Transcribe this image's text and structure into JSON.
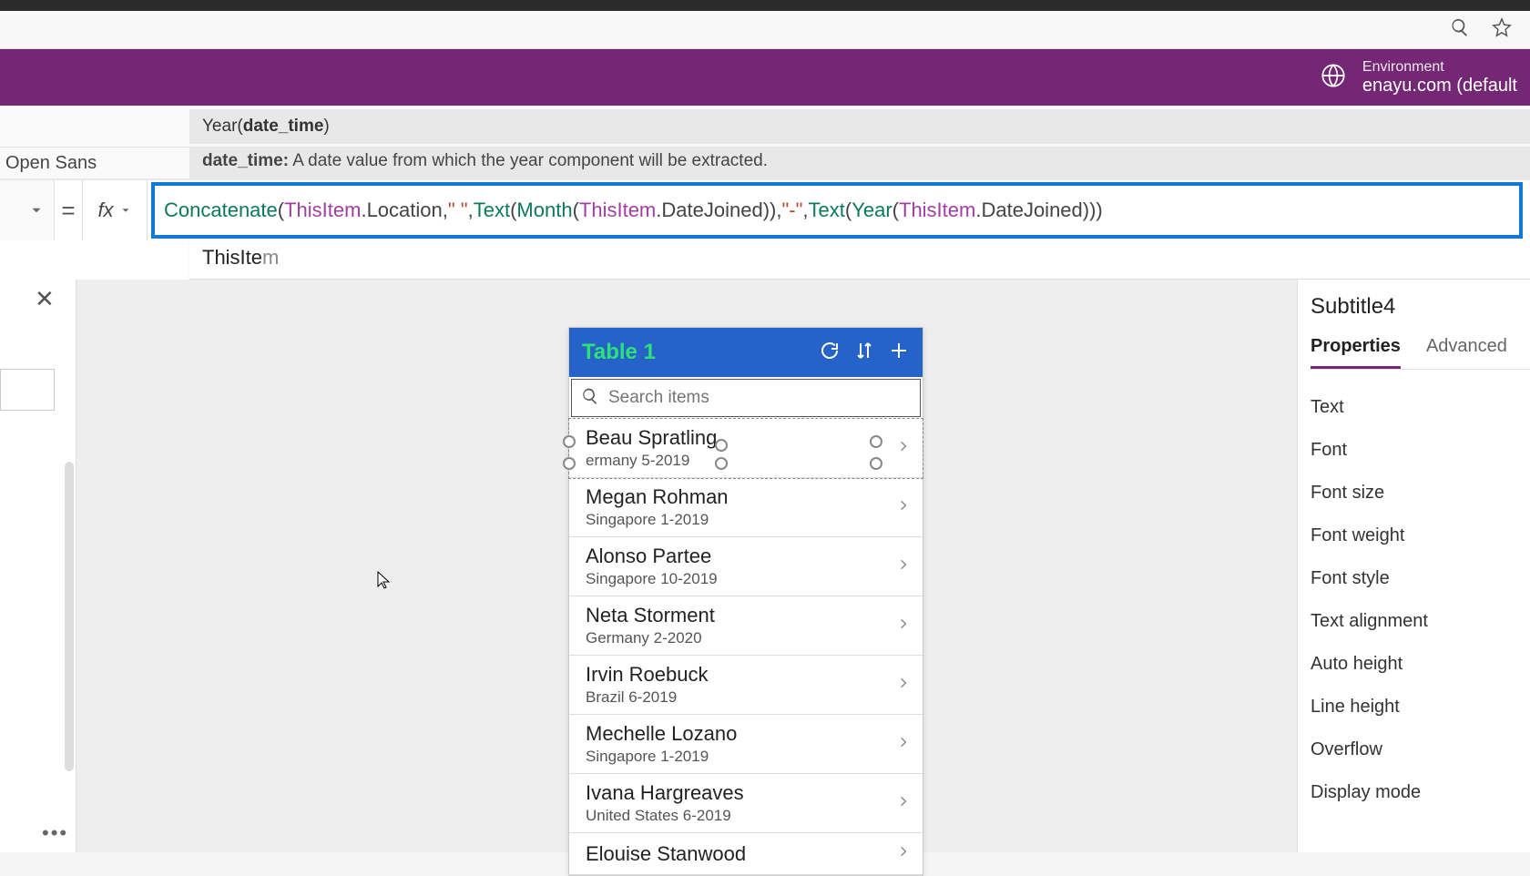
{
  "header": {
    "env_label": "Environment",
    "env_value": "enayu.com (default"
  },
  "toolbar": {
    "font": "Open Sans"
  },
  "signature": {
    "fn": "Year",
    "arg": "date_time",
    "param_name": "date_time:",
    "param_desc": "A date value from which the year component will be extracted."
  },
  "formula": {
    "tokens": [
      {
        "t": "fn",
        "v": "Concatenate"
      },
      {
        "t": "punc",
        "v": "("
      },
      {
        "t": "obj",
        "v": "ThisItem"
      },
      {
        "t": "prop",
        "v": ".Location"
      },
      {
        "t": "punc",
        "v": ", "
      },
      {
        "t": "str",
        "v": "\" \""
      },
      {
        "t": "punc",
        "v": ", "
      },
      {
        "t": "fn",
        "v": "Text"
      },
      {
        "t": "punc",
        "v": "("
      },
      {
        "t": "fn",
        "v": "Month"
      },
      {
        "t": "punc",
        "v": "("
      },
      {
        "t": "obj",
        "v": "ThisItem"
      },
      {
        "t": "prop",
        "v": ".DateJoined"
      },
      {
        "t": "punc",
        "v": ")), "
      },
      {
        "t": "str",
        "v": "\"-\""
      },
      {
        "t": "punc",
        "v": ", "
      },
      {
        "t": "fn",
        "v": "Text"
      },
      {
        "t": "punc",
        "v": "("
      },
      {
        "t": "fn",
        "v": "Year"
      },
      {
        "t": "punc",
        "v": "("
      },
      {
        "t": "obj",
        "v": "ThisItem"
      },
      {
        "t": "prop",
        "v": ".DateJoined"
      },
      {
        "t": "punc",
        "v": ")))"
      }
    ]
  },
  "intellisense": {
    "prefix": "ThisIte",
    "suffix": "m"
  },
  "gallery": {
    "title": "Table 1",
    "search_placeholder": "Search items",
    "items": [
      {
        "name": "Beau Spratling",
        "sub": "ermany 5-2019",
        "selected": true
      },
      {
        "name": "Megan Rohman",
        "sub": "Singapore 1-2019"
      },
      {
        "name": "Alonso Partee",
        "sub": "Singapore 10-2019"
      },
      {
        "name": "Neta Storment",
        "sub": "Germany 2-2020"
      },
      {
        "name": "Irvin Roebuck",
        "sub": "Brazil 6-2019"
      },
      {
        "name": "Mechelle Lozano",
        "sub": "Singapore 1-2019"
      },
      {
        "name": "Ivana Hargreaves",
        "sub": "United States 6-2019"
      },
      {
        "name": "Elouise Stanwood",
        "sub": ""
      }
    ]
  },
  "props": {
    "control_name": "Subtitle4",
    "tabs": {
      "properties": "Properties",
      "advanced": "Advanced"
    },
    "rows": [
      "Text",
      "Font",
      "Font size",
      "Font weight",
      "Font style",
      "Text alignment",
      "Auto height",
      "Line height",
      "Overflow",
      "Display mode"
    ]
  }
}
